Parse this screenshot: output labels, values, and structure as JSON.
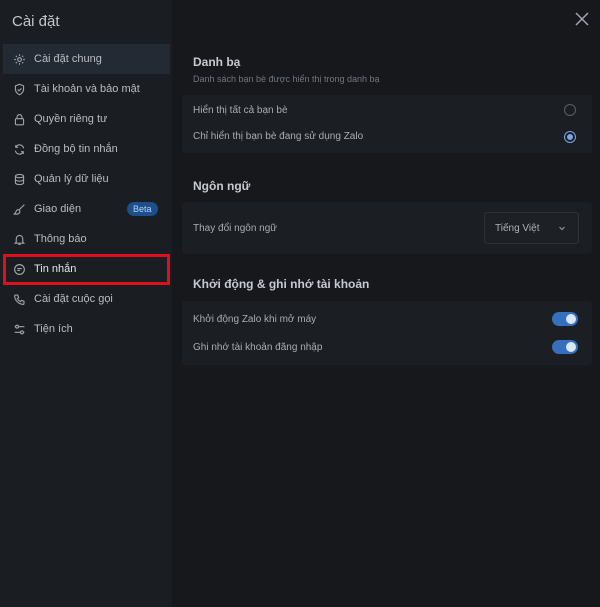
{
  "sidebar": {
    "title": "Cài đặt",
    "items": [
      {
        "label": "Cài đặt chung",
        "icon": "gear-icon"
      },
      {
        "label": "Tài khoản và bảo mật",
        "icon": "shield-icon"
      },
      {
        "label": "Quyền riêng tư",
        "icon": "lock-icon"
      },
      {
        "label": "Đồng bộ tin nhắn",
        "icon": "sync-icon"
      },
      {
        "label": "Quản lý dữ liệu",
        "icon": "database-icon"
      },
      {
        "label": "Giao diện",
        "icon": "brush-icon",
        "badge": "Beta"
      },
      {
        "label": "Thông báo",
        "icon": "bell-icon"
      },
      {
        "label": "Tin nhắn",
        "icon": "message-icon"
      },
      {
        "label": "Cài đặt cuộc gọi",
        "icon": "phone-icon"
      },
      {
        "label": "Tiện ích",
        "icon": "sliders-icon"
      }
    ],
    "active_index": 0,
    "highlighted_index": 7
  },
  "contacts": {
    "title": "Danh bạ",
    "subtitle": "Danh sách bạn bè được hiển thị trong danh bạ",
    "options": [
      {
        "label": "Hiển thị tất cả bạn bè",
        "selected": false
      },
      {
        "label": "Chỉ hiển thị bạn bè đang sử dụng Zalo",
        "selected": true
      }
    ]
  },
  "language": {
    "title": "Ngôn ngữ",
    "row_label": "Thay đổi ngôn ngữ",
    "selected": "Tiếng Việt"
  },
  "startup": {
    "title": "Khởi động & ghi nhớ tài khoản",
    "rows": [
      {
        "label": "Khởi động Zalo khi mở máy",
        "on": true
      },
      {
        "label": "Ghi nhớ tài khoản đăng nhập",
        "on": true
      }
    ]
  },
  "colors": {
    "highlight": "#e0101b",
    "accent": "#356fbd"
  }
}
